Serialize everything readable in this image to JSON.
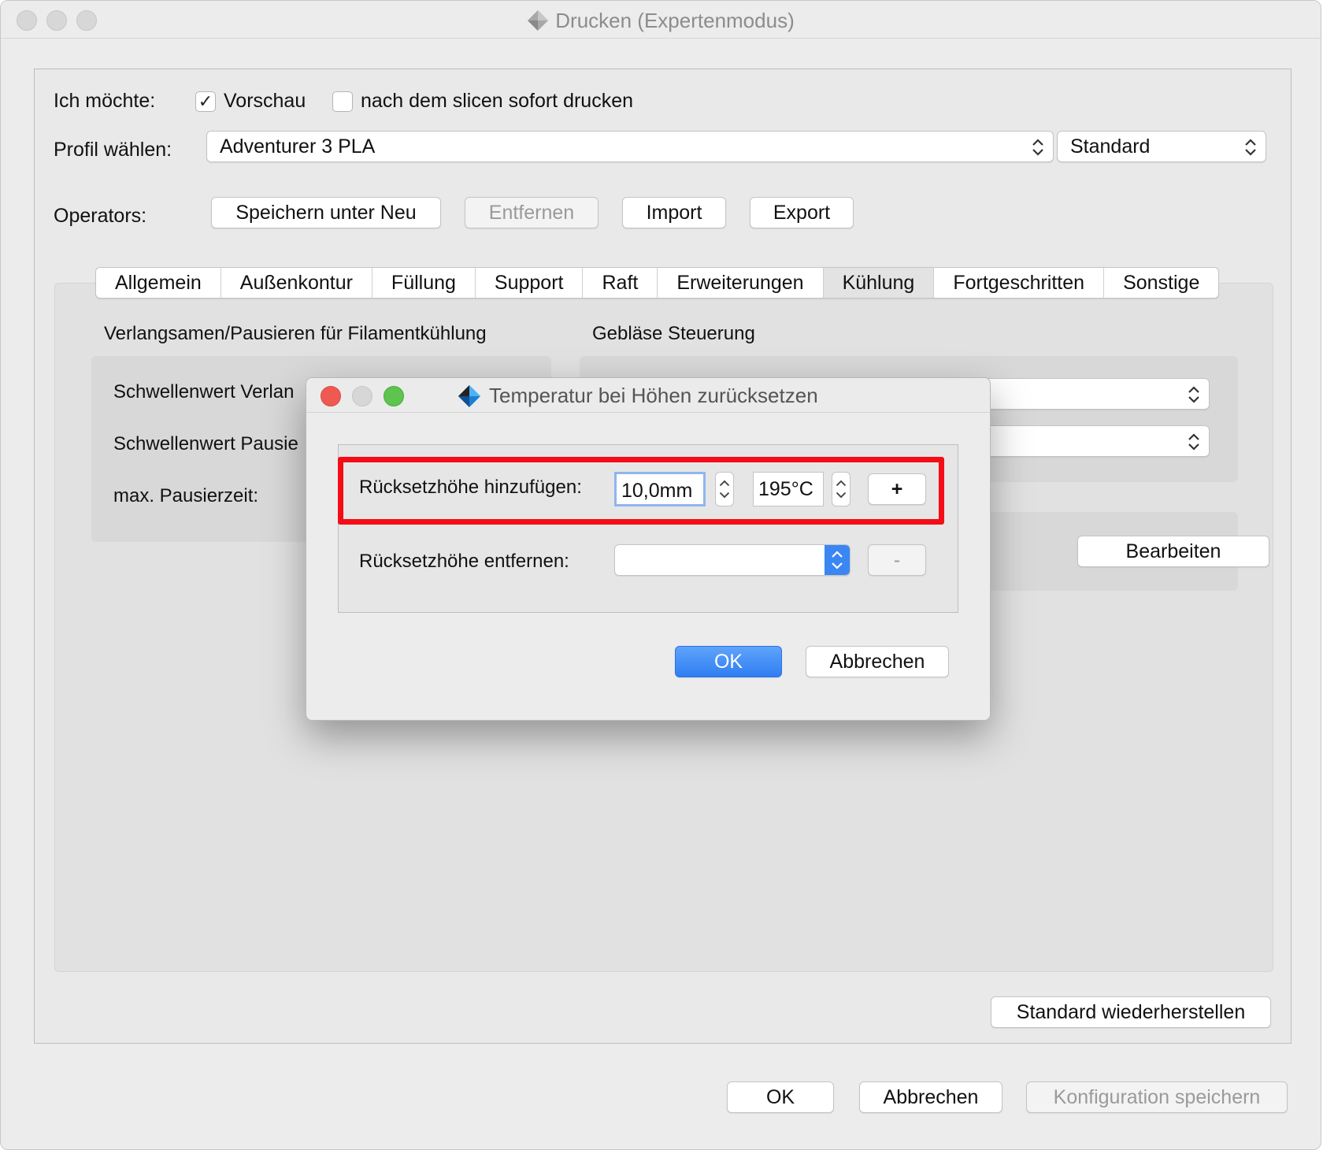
{
  "window": {
    "title": "Drucken (Expertenmodus)"
  },
  "options": {
    "label": "Ich möchte:",
    "preview": {
      "label": "Vorschau",
      "checked": true,
      "check_glyph": "✓"
    },
    "print_after_slice": {
      "label": "nach dem slicen sofort drucken",
      "checked": false
    }
  },
  "profile": {
    "label": "Profil wählen:",
    "selected": "Adventurer 3 PLA",
    "mode": "Standard"
  },
  "operators": {
    "label": "Operators:",
    "buttons": {
      "save_new": "Speichern unter Neu",
      "remove": "Entfernen",
      "import": "Import",
      "export": "Export"
    }
  },
  "tabs": [
    "Allgemein",
    "Außenkontur",
    "Füllung",
    "Support",
    "Raft",
    "Erweiterungen",
    "Kühlung",
    "Fortgeschritten",
    "Sonstige"
  ],
  "active_tab": "Kühlung",
  "cooling": {
    "slowdown_group": {
      "title": "Verlangsamen/Pausieren für Filamentkühlung",
      "rows": [
        "Schwellenwert Verlan",
        "Schwellenwert Pausie",
        "max. Pausierzeit:"
      ]
    },
    "fan_group": {
      "title": "Gebläse Steuerung"
    },
    "edit_button": "Bearbeiten"
  },
  "restore_button": "Standard wiederherstellen",
  "footer": {
    "ok": "OK",
    "cancel": "Abbrechen",
    "save_config": "Konfiguration speichern"
  },
  "dialog": {
    "title": "Temperatur bei Höhen zurücksetzen",
    "add_label": "Rücksetzhöhe hinzufügen:",
    "height_value": "10,0mm",
    "temp_value": "195°C",
    "add_button": "+",
    "remove_label": "Rücksetzhöhe entfernen:",
    "remove_select_value": "",
    "remove_button": "-",
    "ok": "OK",
    "cancel": "Abbrechen",
    "highlight_color": "#f40d16",
    "primary_color": "#2f7ef2"
  }
}
